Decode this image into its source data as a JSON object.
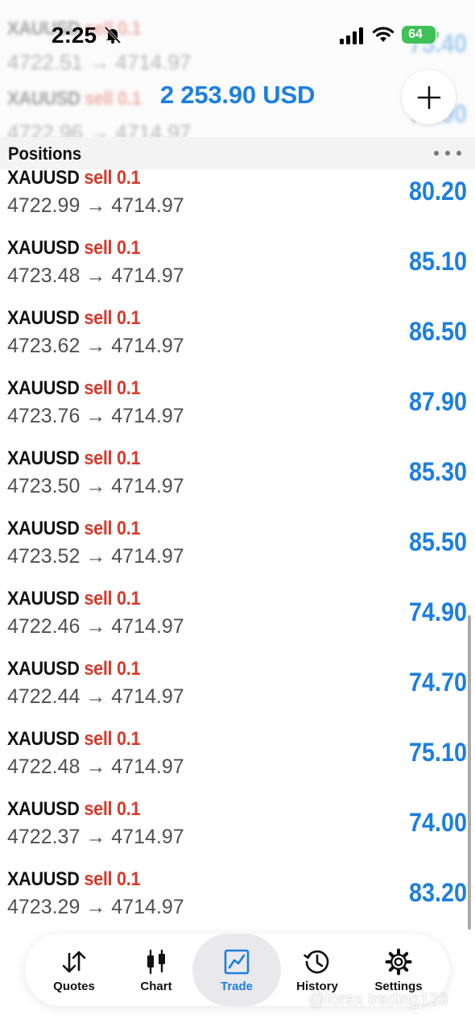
{
  "status_bar": {
    "time": "2:25",
    "battery": "64"
  },
  "header": {
    "balance": "2 253.90 USD"
  },
  "section": {
    "title": "Positions"
  },
  "ghost_rows": [
    {
      "symbol": "XAUUSD",
      "side": "sell",
      "volume": "0.1",
      "open": "4722.51",
      "arrow": "→",
      "current": "4714.97",
      "profit": "75.40"
    },
    {
      "symbol": "XAUUSD",
      "side": "sell",
      "volume": "0.1",
      "open": "4722.96",
      "arrow": "→",
      "current": "4714.97",
      "profit": "79.90"
    }
  ],
  "positions": [
    {
      "symbol": "XAUUSD",
      "side": "sell",
      "volume": "0.1",
      "open": "4722.99",
      "arrow": "→",
      "current": "4714.97",
      "profit": "80.20"
    },
    {
      "symbol": "XAUUSD",
      "side": "sell",
      "volume": "0.1",
      "open": "4723.48",
      "arrow": "→",
      "current": "4714.97",
      "profit": "85.10"
    },
    {
      "symbol": "XAUUSD",
      "side": "sell",
      "volume": "0.1",
      "open": "4723.62",
      "arrow": "→",
      "current": "4714.97",
      "profit": "86.50"
    },
    {
      "symbol": "XAUUSD",
      "side": "sell",
      "volume": "0.1",
      "open": "4723.76",
      "arrow": "→",
      "current": "4714.97",
      "profit": "87.90"
    },
    {
      "symbol": "XAUUSD",
      "side": "sell",
      "volume": "0.1",
      "open": "4723.50",
      "arrow": "→",
      "current": "4714.97",
      "profit": "85.30"
    },
    {
      "symbol": "XAUUSD",
      "side": "sell",
      "volume": "0.1",
      "open": "4723.52",
      "arrow": "→",
      "current": "4714.97",
      "profit": "85.50"
    },
    {
      "symbol": "XAUUSD",
      "side": "sell",
      "volume": "0.1",
      "open": "4722.46",
      "arrow": "→",
      "current": "4714.97",
      "profit": "74.90"
    },
    {
      "symbol": "XAUUSD",
      "side": "sell",
      "volume": "0.1",
      "open": "4722.44",
      "arrow": "→",
      "current": "4714.97",
      "profit": "74.70"
    },
    {
      "symbol": "XAUUSD",
      "side": "sell",
      "volume": "0.1",
      "open": "4722.48",
      "arrow": "→",
      "current": "4714.97",
      "profit": "75.10"
    },
    {
      "symbol": "XAUUSD",
      "side": "sell",
      "volume": "0.1",
      "open": "4722.37",
      "arrow": "→",
      "current": "4714.97",
      "profit": "74.00"
    },
    {
      "symbol": "XAUUSD",
      "side": "sell",
      "volume": "0.1",
      "open": "4723.29",
      "arrow": "→",
      "current": "4714.97",
      "profit": "83.20"
    }
  ],
  "tabs": [
    {
      "label": "Quotes",
      "icon": "quotes-arrows-icon",
      "active": false
    },
    {
      "label": "Chart",
      "icon": "candlestick-icon",
      "active": false
    },
    {
      "label": "Trade",
      "icon": "trend-line-icon",
      "active": true
    },
    {
      "label": "History",
      "icon": "history-clock-icon",
      "active": false
    },
    {
      "label": "Settings",
      "icon": "gear-icon",
      "active": false
    }
  ],
  "watermark": "@forex trading123",
  "colors": {
    "accent": "#1c7fe0",
    "sell": "#d8392c",
    "battery": "#3ec158"
  }
}
